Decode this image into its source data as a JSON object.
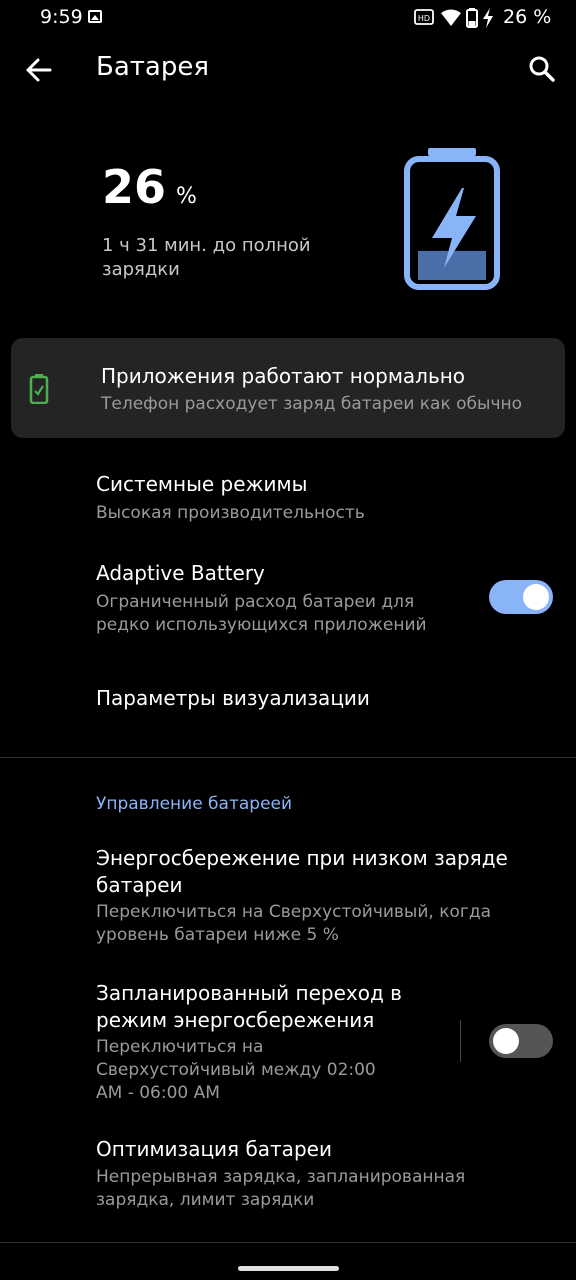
{
  "status_bar": {
    "time": "9:59",
    "right_text": "26 %",
    "icons": [
      "gallery-icon",
      "hd-voice-icon",
      "wifi-icon",
      "battery-icon",
      "bolt-icon"
    ]
  },
  "app_bar": {
    "title": "Батарея"
  },
  "battery": {
    "percent_value": "26",
    "percent_unit": "%",
    "subtext": "1 ч 31 мин. до полной зарядки",
    "accent_color": "#8ab4f8",
    "level": 0.26
  },
  "status_card": {
    "title": "Приложения работают нормально",
    "subtitle": "Телефон расходует заряд батареи как обычно",
    "icon_color": "#4caf50"
  },
  "items": [
    {
      "title": "Системные режимы",
      "subtitle": "Высокая производительность"
    },
    {
      "title": "Adaptive Battery",
      "subtitle": "Ограниченный расход батареи для редко использующихся приложений",
      "toggle_on": true
    },
    {
      "title": "Параметры визуализации"
    }
  ],
  "battery_management": {
    "header": "Управление батареей",
    "items": [
      {
        "title": "Энергосбережение при низком заряде батареи",
        "subtitle": "Переключиться на Сверхустойчивый, когда уровень батареи ниже 5 %"
      },
      {
        "title": "Запланированный переход в режим энергосбережения",
        "subtitle": "Переключиться на Сверхустойчивый между 02:00 AM - 06:00 AM",
        "toggle_on": false
      },
      {
        "title": "Оптимизация батареи",
        "subtitle": "Непрерывная зарядка, запланированная зарядка, лимит зарядки"
      }
    ]
  }
}
